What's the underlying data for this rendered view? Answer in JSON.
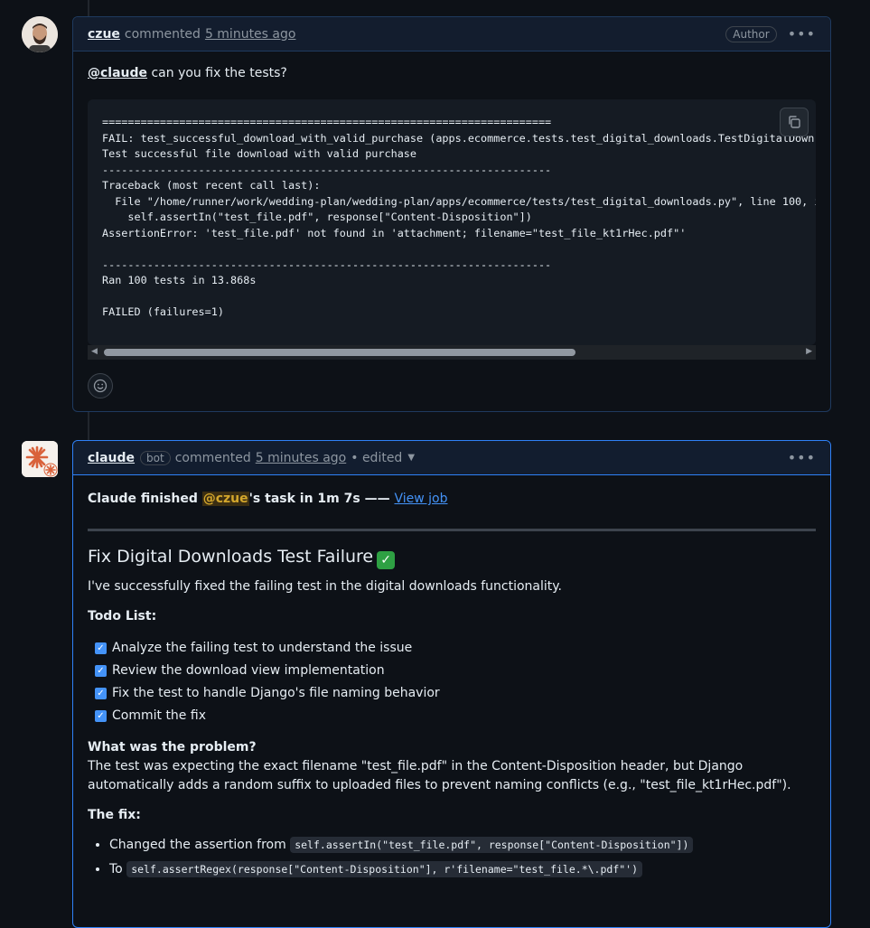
{
  "comment1": {
    "author": "czue",
    "action": "commented",
    "time": "5 minutes ago",
    "badge": "Author",
    "mention": "@claude",
    "text": " can you fix the tests?",
    "code_lines": [
      "======================================================================",
      "FAIL: test_successful_download_with_valid_purchase (apps.ecommerce.tests.test_digital_downloads.TestDigitalDown",
      "Test successful file download with valid purchase",
      "----------------------------------------------------------------------",
      "Traceback (most recent call last):",
      "  File \"/home/runner/work/wedding-plan/wedding-plan/apps/ecommerce/tests/test_digital_downloads.py\", line 100, in",
      "    self.assertIn(\"test_file.pdf\", response[\"Content-Disposition\"])",
      "AssertionError: 'test_file.pdf' not found in 'attachment; filename=\"test_file_kt1rHec.pdf\"'",
      "",
      "----------------------------------------------------------------------",
      "Ran 100 tests in 13.868s",
      "",
      "FAILED (failures=1)"
    ]
  },
  "comment2": {
    "author": "claude",
    "bot_badge": "bot",
    "action": "commented",
    "time": "5 minutes ago",
    "edited": "• edited",
    "finished_prefix": "Claude finished ",
    "finished_mention": "@czue",
    "finished_suffix": "'s task in 1m 7s —— ",
    "view_job": "View job",
    "heading": "Fix Digital Downloads Test Failure",
    "intro": "I've successfully fixed the failing test in the digital downloads functionality.",
    "todo_title": "Todo List:",
    "todos": [
      "Analyze the failing test to understand the issue",
      "Review the download view implementation",
      "Fix the test to handle Django's file naming behavior",
      "Commit the fix"
    ],
    "problem_title": "What was the problem?",
    "problem_text": "The test was expecting the exact filename \"test_file.pdf\" in the Content-Disposition header, but Django automatically adds a random suffix to uploaded files to prevent naming conflicts (e.g., \"test_file_kt1rHec.pdf\").",
    "fix_title": "The fix:",
    "fix_1_prefix": "Changed the assertion from ",
    "fix_1_code": "self.assertIn(\"test_file.pdf\", response[\"Content-Disposition\"])",
    "fix_2_prefix": "To ",
    "fix_2_code": "self.assertRegex(response[\"Content-Disposition\"], r'filename=\"test_file.*\\.pdf\"')"
  }
}
